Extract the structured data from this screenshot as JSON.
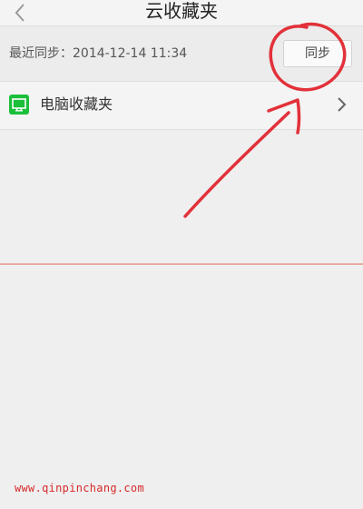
{
  "header": {
    "title": "云收藏夹",
    "back_icon": "chevron-left-icon"
  },
  "sync": {
    "last_sync_text": "最近同步：2014-12-14 11:34",
    "sync_button_label": "同步"
  },
  "list": {
    "items": [
      {
        "label": "电脑收藏夹",
        "icon": "monitor-icon",
        "icon_color": "#1bbf3a",
        "trailing_icon": "chevron-right-icon"
      }
    ]
  },
  "colors": {
    "annotation": "#e2313a",
    "divider": "#e36a5a",
    "watermark": "#d62a2a"
  },
  "watermark": {
    "text": "www.qinpinchang.com"
  }
}
